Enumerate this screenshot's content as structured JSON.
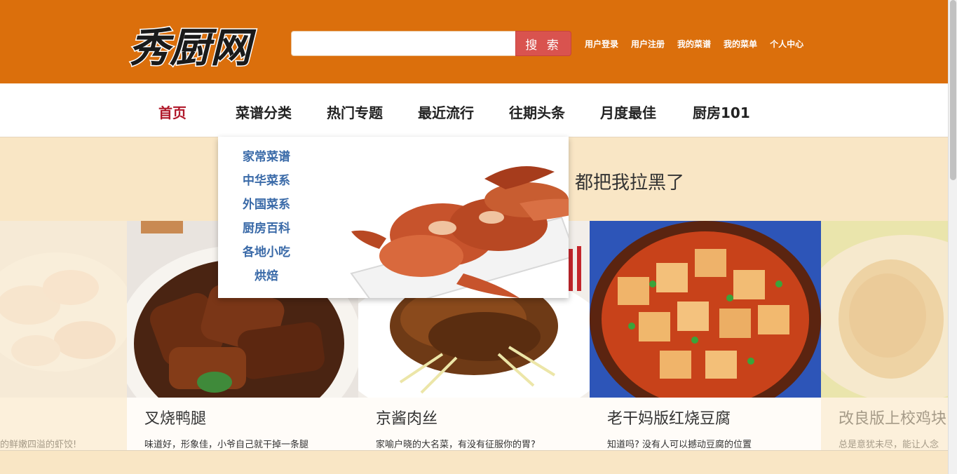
{
  "header": {
    "logo_text": "秀厨网",
    "search": {
      "value": "",
      "placeholder": "",
      "button_label": "搜 索"
    },
    "links": [
      "用户登录",
      "用户注册",
      "我的菜谱",
      "我的菜单",
      "个人中心"
    ],
    "colors": {
      "header_bg": "#db6f0c",
      "search_button": "#d9534f"
    }
  },
  "nav": {
    "items": [
      "首页",
      "菜谱分类",
      "热门专题",
      "最近流行",
      "往期头条",
      "月度最佳",
      "厨房101"
    ],
    "active_item": "首页"
  },
  "dropdown": {
    "items": [
      "家常菜谱",
      "中华菜系",
      "外国菜系",
      "厨房百科",
      "各地小吃",
      "烘焙"
    ]
  },
  "notice": {
    "text": "都把我拉黑了"
  },
  "cards": [
    {
      "title": "",
      "desc": "的鲜嫩四溢的虾饺!"
    },
    {
      "title": "叉烧鸭腿",
      "desc": "味道好，形象佳，小爷自己就干掉一条腿"
    },
    {
      "title": "京酱肉丝",
      "desc": "家喻户晓的大名菜，有没有征服你的胃?"
    },
    {
      "title": "老干妈版红烧豆腐",
      "desc": "知道吗? 没有人可以撼动豆腐的位置"
    },
    {
      "title": "改良版上校鸡块",
      "desc": "总是意犹未尽，能让人念"
    }
  ]
}
